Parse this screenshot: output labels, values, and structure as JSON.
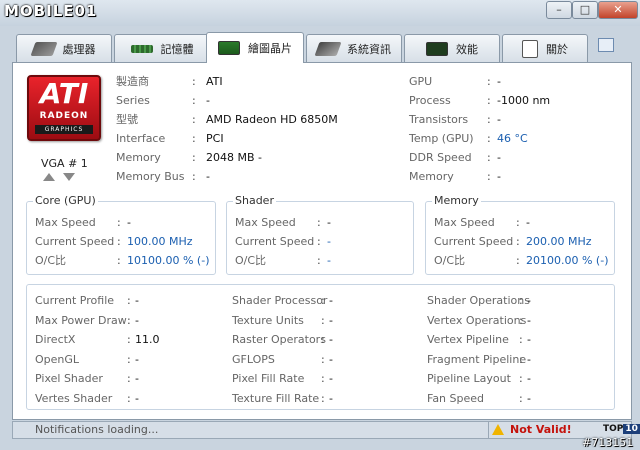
{
  "watermark_brand": "MOBILE01",
  "watermark_id": "#713151",
  "window": {
    "minimize": "–",
    "maximize": "□",
    "close": "✕"
  },
  "tabs": [
    {
      "label": "處理器",
      "icon": "cpu-icon"
    },
    {
      "label": "記憶體",
      "icon": "memory-icon"
    },
    {
      "label": "繪圖晶片",
      "icon": "graphics-card-icon"
    },
    {
      "label": "系統資訊",
      "icon": "motherboard-icon"
    },
    {
      "label": "效能",
      "icon": "performance-icon"
    },
    {
      "label": "關於",
      "icon": "about-icon"
    }
  ],
  "active_tab": 2,
  "logo": {
    "brand": "ATI",
    "line1": "RADEON",
    "line2": "GRAPHICS"
  },
  "vga": {
    "label": "VGA # 1"
  },
  "info_left": [
    {
      "label": "製造商",
      "value": "ATI"
    },
    {
      "label": "Series",
      "value": "-"
    },
    {
      "label": "型號",
      "value": "AMD Radeon HD 6850M"
    },
    {
      "label": "Interface",
      "value": "PCI"
    },
    {
      "label": "Memory",
      "value": "2048 MB -"
    },
    {
      "label": "Memory Bus",
      "value": "-"
    }
  ],
  "info_right": [
    {
      "label": "GPU",
      "value": "-"
    },
    {
      "label": "Process",
      "value": "-1000 nm"
    },
    {
      "label": "Transistors",
      "value": "-"
    },
    {
      "label": "Temp (GPU)",
      "value": "46 °C"
    },
    {
      "label": "DDR Speed",
      "value": "-"
    },
    {
      "label": "Memory",
      "value": "-"
    }
  ],
  "groups": [
    {
      "title": "Core (GPU)",
      "rows": [
        {
          "label": "Max Speed",
          "value": "-"
        },
        {
          "label": "Current Speed",
          "value": "100.00 MHz"
        },
        {
          "label": "O/C比",
          "value": "10100.00 % (-)"
        }
      ]
    },
    {
      "title": "Shader",
      "rows": [
        {
          "label": "Max Speed",
          "value": "-"
        },
        {
          "label": "Current Speed",
          "value": "-"
        },
        {
          "label": "O/C比",
          "value": "-"
        }
      ]
    },
    {
      "title": "Memory",
      "rows": [
        {
          "label": "Max Speed",
          "value": "-"
        },
        {
          "label": "Current Speed",
          "value": "200.00 MHz"
        },
        {
          "label": "O/C比",
          "value": "20100.00 % (-)"
        }
      ]
    }
  ],
  "details": [
    [
      {
        "label": "Current Profile",
        "value": "-"
      },
      {
        "label": "Max Power Draw",
        "value": "-"
      },
      {
        "label": "DirectX",
        "value": "11.0"
      },
      {
        "label": "OpenGL",
        "value": "-"
      },
      {
        "label": "Pixel Shader",
        "value": "-"
      },
      {
        "label": "Vertes Shader",
        "value": "-"
      }
    ],
    [
      {
        "label": "Shader Processor",
        "value": "-"
      },
      {
        "label": "Texture Units",
        "value": "-"
      },
      {
        "label": "Raster Operators",
        "value": "-"
      },
      {
        "label": "GFLOPS",
        "value": "-"
      },
      {
        "label": "Pixel Fill Rate",
        "value": "-"
      },
      {
        "label": "Texture Fill Rate",
        "value": "-"
      }
    ],
    [
      {
        "label": "Shader Operations",
        "value": "-"
      },
      {
        "label": "Vertex Operations",
        "value": "-"
      },
      {
        "label": "Vertex Pipeline",
        "value": "-"
      },
      {
        "label": "Fragment Pipeline",
        "value": "-"
      },
      {
        "label": "Pipeline Layout",
        "value": "-"
      },
      {
        "label": "Fan Speed",
        "value": "-"
      }
    ]
  ],
  "status": {
    "text": "Notifications loading...",
    "warning": "Not Valid!",
    "badge": "TOP",
    "badge_num": "10"
  },
  "colors": {
    "accent_blue": "#1b5fb0",
    "warning_red": "#c4120c",
    "ati_red": "#e9232b"
  }
}
